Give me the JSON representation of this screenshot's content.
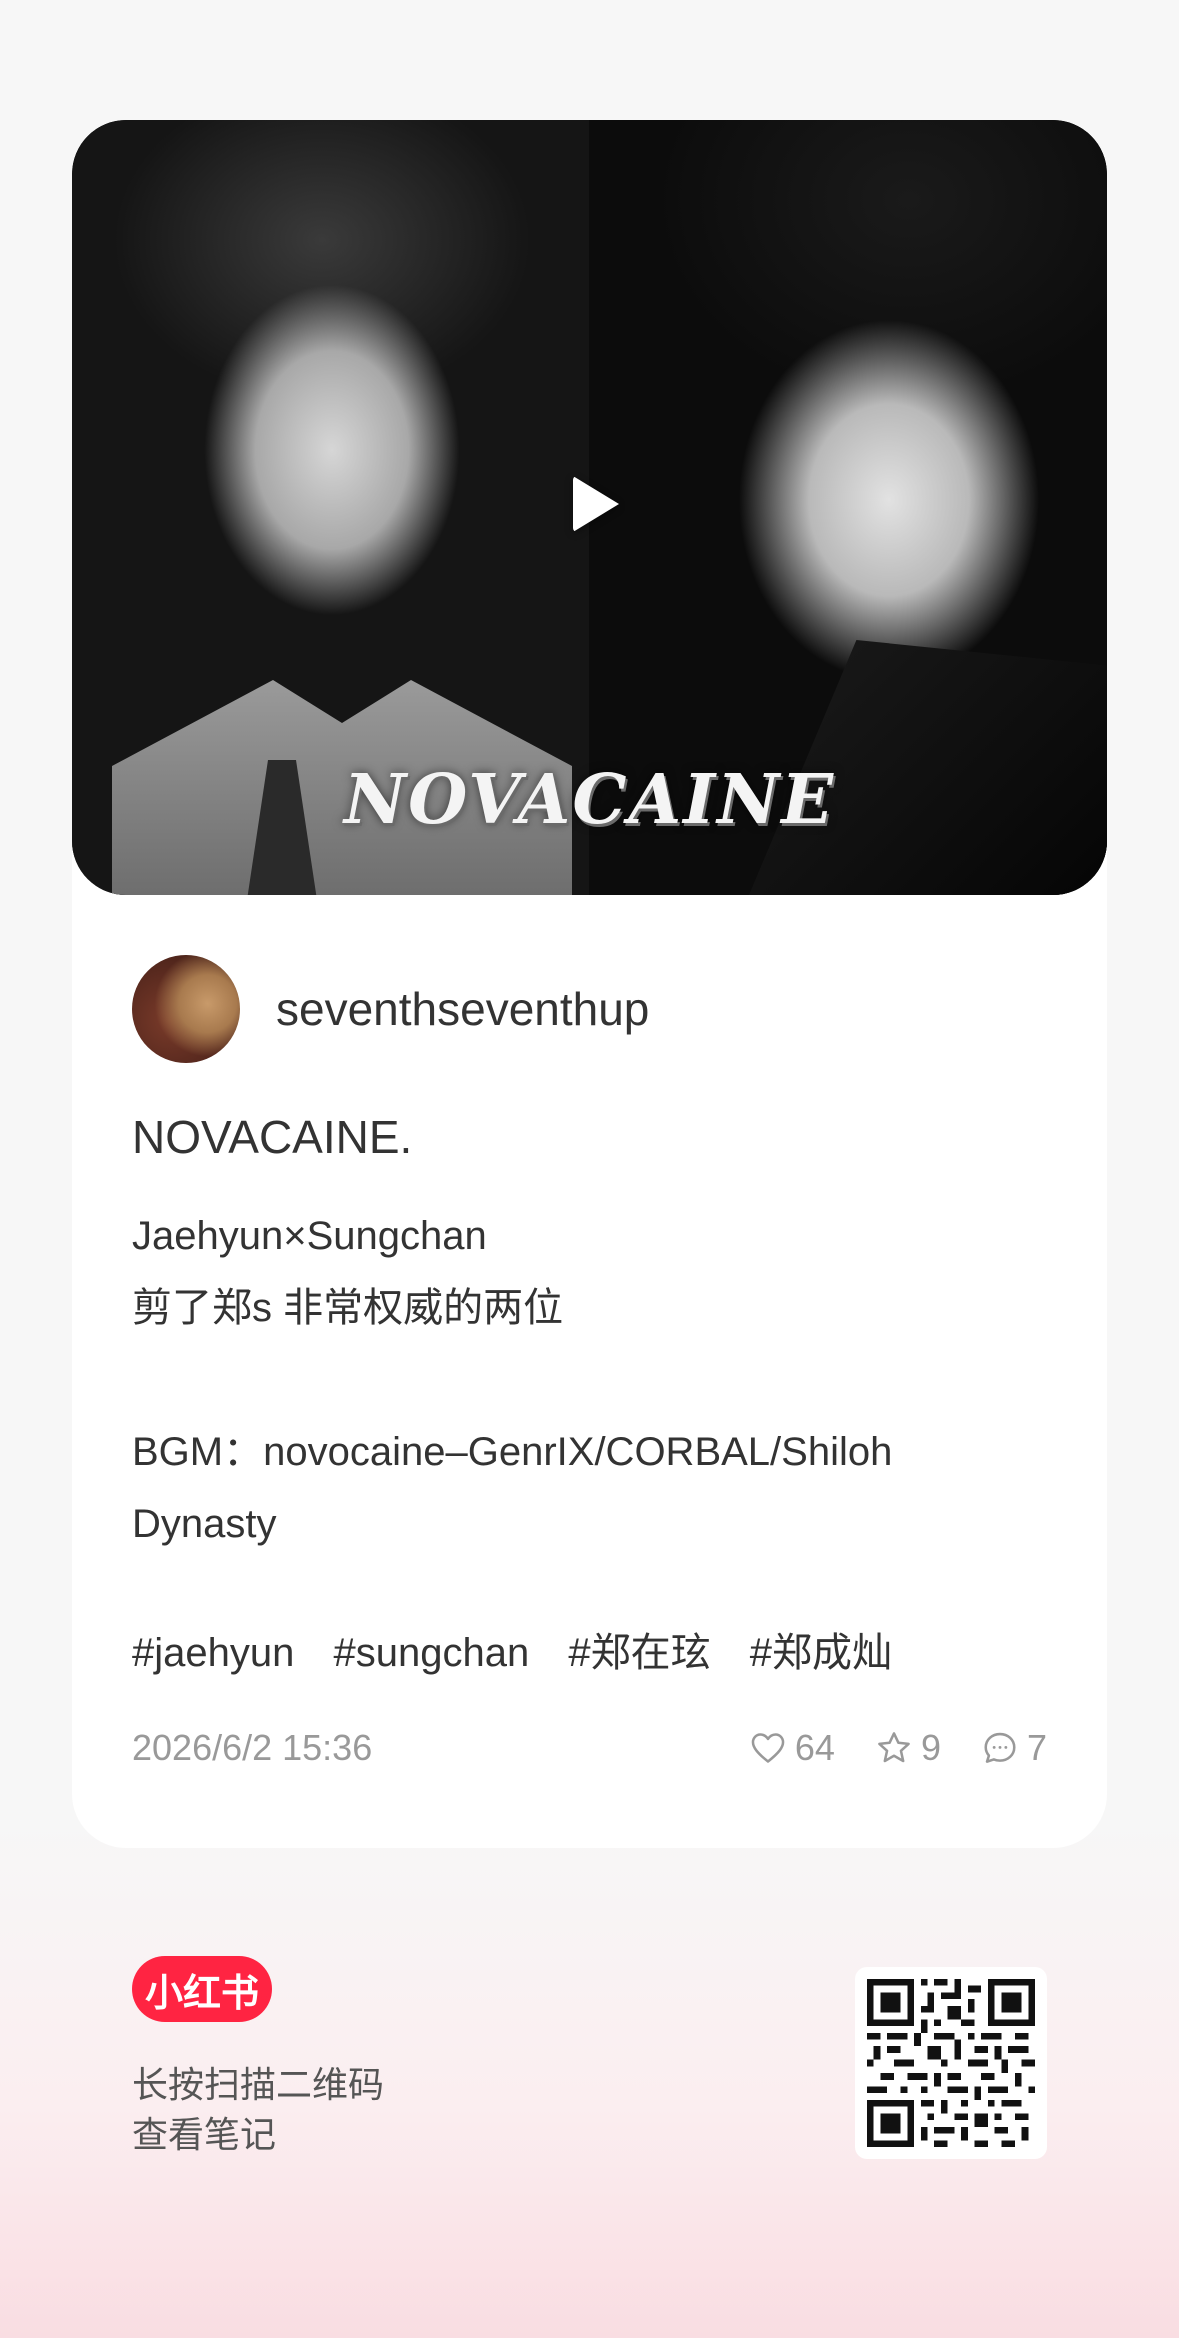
{
  "cover": {
    "title": "NOVACAINE",
    "subtitle": "Jaehyun × Sungchan"
  },
  "author": {
    "username": "seventhseventhup"
  },
  "note": {
    "title": "NOVACAINE.",
    "lines": [
      "Jaehyun×Sungchan",
      "剪了郑s  非常权威的两位",
      "",
      "BGM：novocaine–GenrIX/CORBAL/Shiloh",
      "Dynasty",
      ""
    ],
    "tags": [
      "#jaehyun",
      "#sungchan",
      "#郑在玹",
      "#郑成灿"
    ]
  },
  "meta": {
    "datetime": "2026/6/2 15:36",
    "likes": "64",
    "collects": "9",
    "comments": "7"
  },
  "footer": {
    "logo": "小红书",
    "line1": "长按扫描二维码",
    "line2": "查看笔记"
  },
  "colors": {
    "brand": "#ff2442",
    "meta_text": "#999999",
    "body_text": "#333333"
  },
  "icons": {
    "play": "play-icon",
    "like": "heart-icon",
    "collect": "star-icon",
    "comment": "comment-icon",
    "qr": "qr-code-icon"
  }
}
